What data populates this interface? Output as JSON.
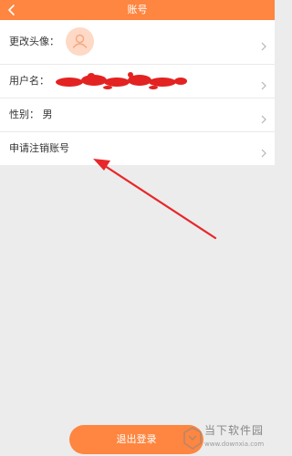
{
  "header": {
    "title": "账号"
  },
  "rows": [
    {
      "label": "更改头像："
    },
    {
      "label": "用户名："
    },
    {
      "label": "性别： 男"
    },
    {
      "label": "申请注销账号"
    }
  ],
  "logout_label": "退出登录",
  "watermark": {
    "text": "当下软件园",
    "url": "www.downxia.com"
  },
  "colors": {
    "accent": "#fe8640",
    "annotation_arrow": "#e8272a",
    "avatar_bg": "#fdd9c6"
  }
}
